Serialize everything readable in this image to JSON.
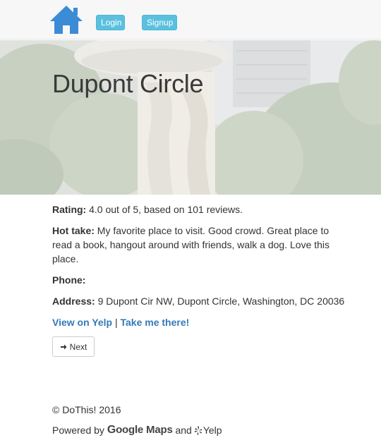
{
  "nav": {
    "home_icon": "home-icon",
    "login_label": "Login",
    "signup_label": "Signup"
  },
  "hero": {
    "title": "Dupont Circle"
  },
  "details": {
    "rating_label": "Rating:",
    "rating_value": "4.0 out of 5, based on 101 reviews.",
    "hottake_label": "Hot take:",
    "hottake_value": "My favorite place to visit. Good crowd. Great place to read a book, hangout around with friends, walk a dog. Love this place.",
    "phone_label": "Phone:",
    "phone_value": "",
    "address_label": "Address:",
    "address_value": "9 Dupont Cir NW, Dupont Circle, Washington, DC 20036"
  },
  "links": {
    "yelp_label": "View on Yelp",
    "separator": "|",
    "directions_label": "Take me there!"
  },
  "next_button": {
    "label": "Next",
    "icon": "arrow-right-icon"
  },
  "footer": {
    "copyright": "© DoThis! 2016",
    "powered_prefix": "Powered by",
    "google_g": "G",
    "google_rest": "oogle Maps",
    "and": "and",
    "yelp": "Yelp",
    "yelp_icon": "yelp-burst-icon"
  },
  "colors": {
    "info_button": "#5bc0de",
    "link": "#337ab7",
    "home_icon": "#3b8bd6"
  }
}
